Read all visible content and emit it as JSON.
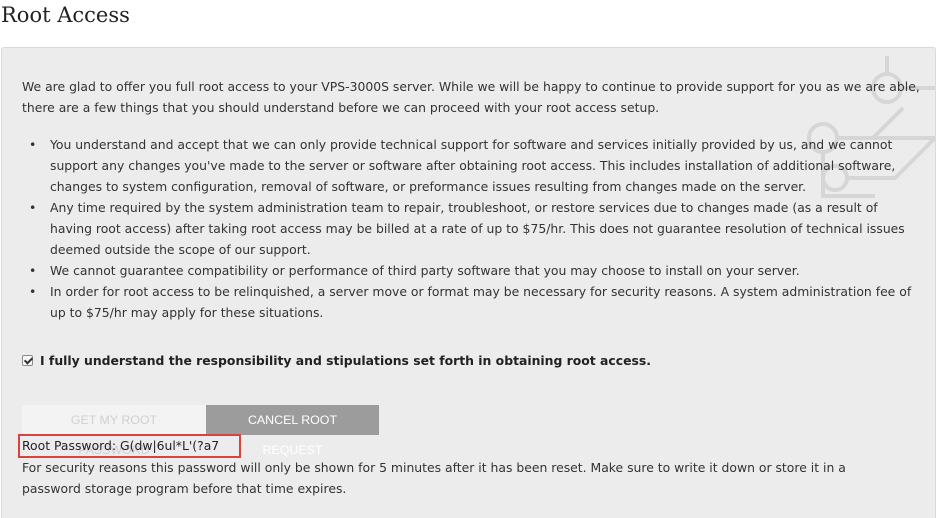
{
  "page": {
    "title": "Root Access"
  },
  "intro": "We are glad to offer you full root access to your VPS-3000S server. While we will be happy to continue to provide support for you as we are able, there are a few things that you should understand before we can proceed with your root access setup.",
  "terms": [
    "You understand and accept that we can only provide technical support for software and services initially provided by us, and we cannot support any changes you've made to the server or software after obtaining root access. This includes installation of additional software, changes to system configuration, removal of software, or preformance issues resulting from changes made on the server.",
    "Any time required by the system administration team to repair, troubleshoot, or restore services due to changes made (as a result of having root access) after taking root access may be billed at a rate of up to $75/hr. This does not guarantee resolution of technical issues deemed outside the scope of our support.",
    "We cannot guarantee compatibility or performance of third party software that you may choose to install on your server.",
    "In order for root access to be relinquished, a server move or format may be necessary for security reasons. A system administration fee of up to $75/hr may apply for these situations."
  ],
  "acknowledgement": {
    "checked": true,
    "label": "I fully understand the responsibility and stipulations set forth in obtaining root access."
  },
  "buttons": {
    "get_password": "GET MY ROOT PASSWORD",
    "cancel_request": "CANCEL ROOT REQUEST"
  },
  "password": {
    "label": "Root Password:",
    "value": "G(dw|6ul*L'(?a7"
  },
  "note": "For security reasons this password will only be shown for 5 minutes after it has been reset. Make sure to write it down or store it in a password storage program before that time expires.",
  "colors": {
    "panel_background": "#ececec",
    "cancel_button": "#9c9c9c",
    "disabled_button": "#f3f3f3",
    "highlight_border": "#d9423e"
  },
  "icons": {
    "panel_decoration": "circuit-pattern-icon",
    "checkbox": "checkmark-icon",
    "bullet": "bullet-icon"
  }
}
